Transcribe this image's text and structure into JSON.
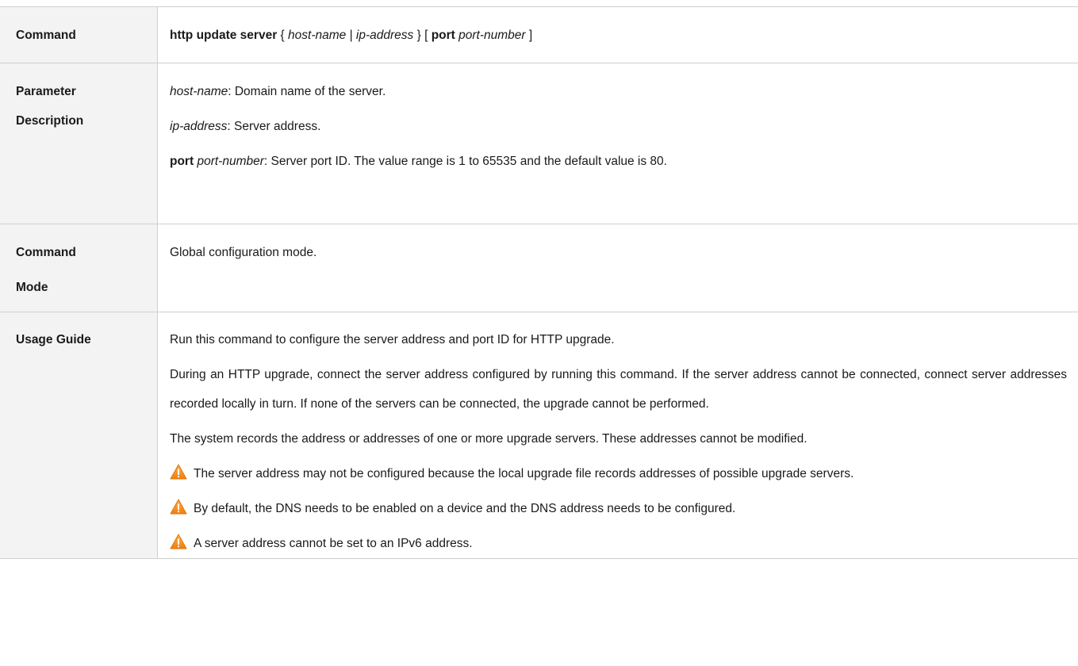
{
  "rows": {
    "command": {
      "label": "Command",
      "syntax": {
        "kw1": "http update server",
        "open_brace": " { ",
        "arg1": "host-name",
        "pipe": " | ",
        "arg2": "ip-address",
        "close_brace_open_bracket": " } [ ",
        "kw2": "port",
        "space": " ",
        "arg3": "port-number",
        "close_bracket": " ]"
      }
    },
    "parameter": {
      "label_line1": "Parameter",
      "label_line2": "Description",
      "p1_term": "host-name",
      "p1_text": ": Domain name of the server.",
      "p2_term": "ip-address",
      "p2_text": ": Server address.",
      "p3_kw": "port",
      "p3_space": " ",
      "p3_term": "port-number",
      "p3_text": ": Server port ID. The value range is 1 to 65535 and the default value is 80."
    },
    "mode": {
      "label_line1": "Command",
      "label_line2": "Mode",
      "text": "Global configuration mode."
    },
    "usage": {
      "label": "Usage Guide",
      "p1": "Run this command to configure the server address and port ID for HTTP upgrade.",
      "p2": "During an HTTP upgrade, connect the server address configured by running this command. If the server address cannot be connected, connect server addresses recorded locally in turn. If none of the servers can be connected, the upgrade cannot be performed.",
      "p3": "The system records the address or addresses of one or more upgrade servers. These addresses cannot be modified.",
      "warn1": "The server address may not be configured because the local upgrade file records addresses of possible upgrade servers.",
      "warn2": "By default, the DNS needs to be enabled on a device and the DNS address needs to be configured.",
      "warn3": "A server address cannot be set to an IPv6 address."
    }
  },
  "icons": {
    "warning": "warning-triangle-icon"
  },
  "colors": {
    "label_background": "#f3f3f3",
    "border": "#cfcfcf",
    "warning_orange": "#f39a1e"
  }
}
